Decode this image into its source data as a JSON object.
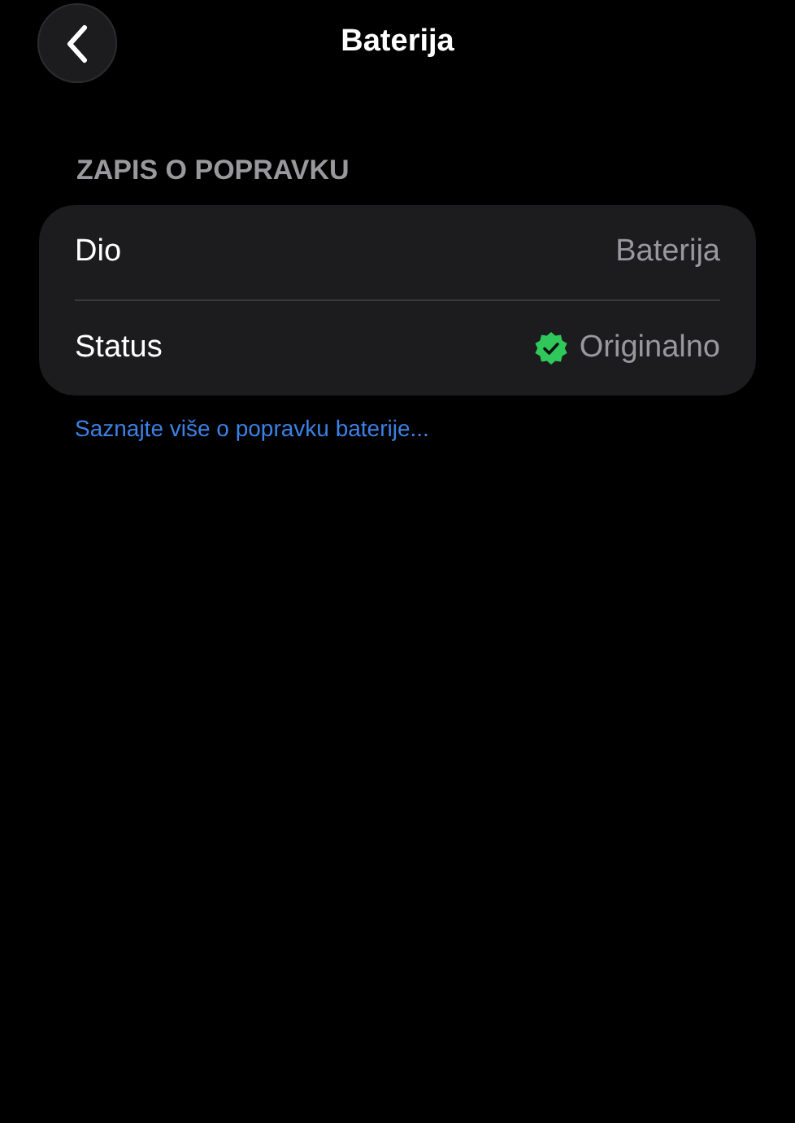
{
  "nav": {
    "title": "Baterija"
  },
  "section": {
    "header": "ZAPIS O POPRAVKU",
    "rows": [
      {
        "kind": "text",
        "label": "Dio",
        "value": "Baterija"
      },
      {
        "kind": "verified",
        "label": "Status",
        "value": "Originalno"
      }
    ]
  },
  "link": "Saznajte više o popravku baterije..."
}
